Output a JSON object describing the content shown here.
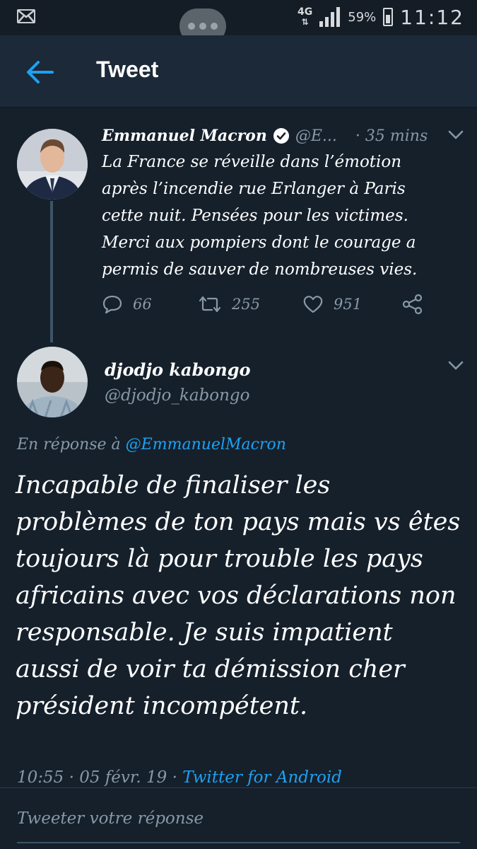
{
  "status_bar": {
    "network": "4G",
    "battery": "59%",
    "time": "11:12"
  },
  "app_bar": {
    "title": "Tweet"
  },
  "original_tweet": {
    "author_name": "Emmanuel Macron",
    "author_handle": "@E...",
    "time": "· 35 mins",
    "text": "La France se réveille dans l’émotion après l’incendie rue Erlanger à Paris cette nuit. Pensées pour les victimes. Merci aux pompiers dont le courage a permis de sauver de nombreuses vies.",
    "replies": "66",
    "retweets": "255",
    "likes": "951"
  },
  "reply_tweet": {
    "author_name": "djodjo kabongo",
    "author_handle": "@djodjo_kabongo",
    "in_reply_prefix": "En réponse à ",
    "in_reply_mention": "@EmmanuelMacron",
    "text": "Incapable de finaliser les problèmes de ton pays mais vs êtes toujours là pour trouble les pays africains avec vos déclarations non responsable. Je suis impatient aussi de voir ta démission cher président incompétent.",
    "timestamp": "10:55 · 05 févr. 19 · ",
    "client": "Twitter for Android"
  },
  "compose": {
    "placeholder": "Tweeter votre réponse"
  },
  "colors": {
    "background": "#15202b",
    "accent": "#1da1f2",
    "muted": "#8899a6"
  }
}
